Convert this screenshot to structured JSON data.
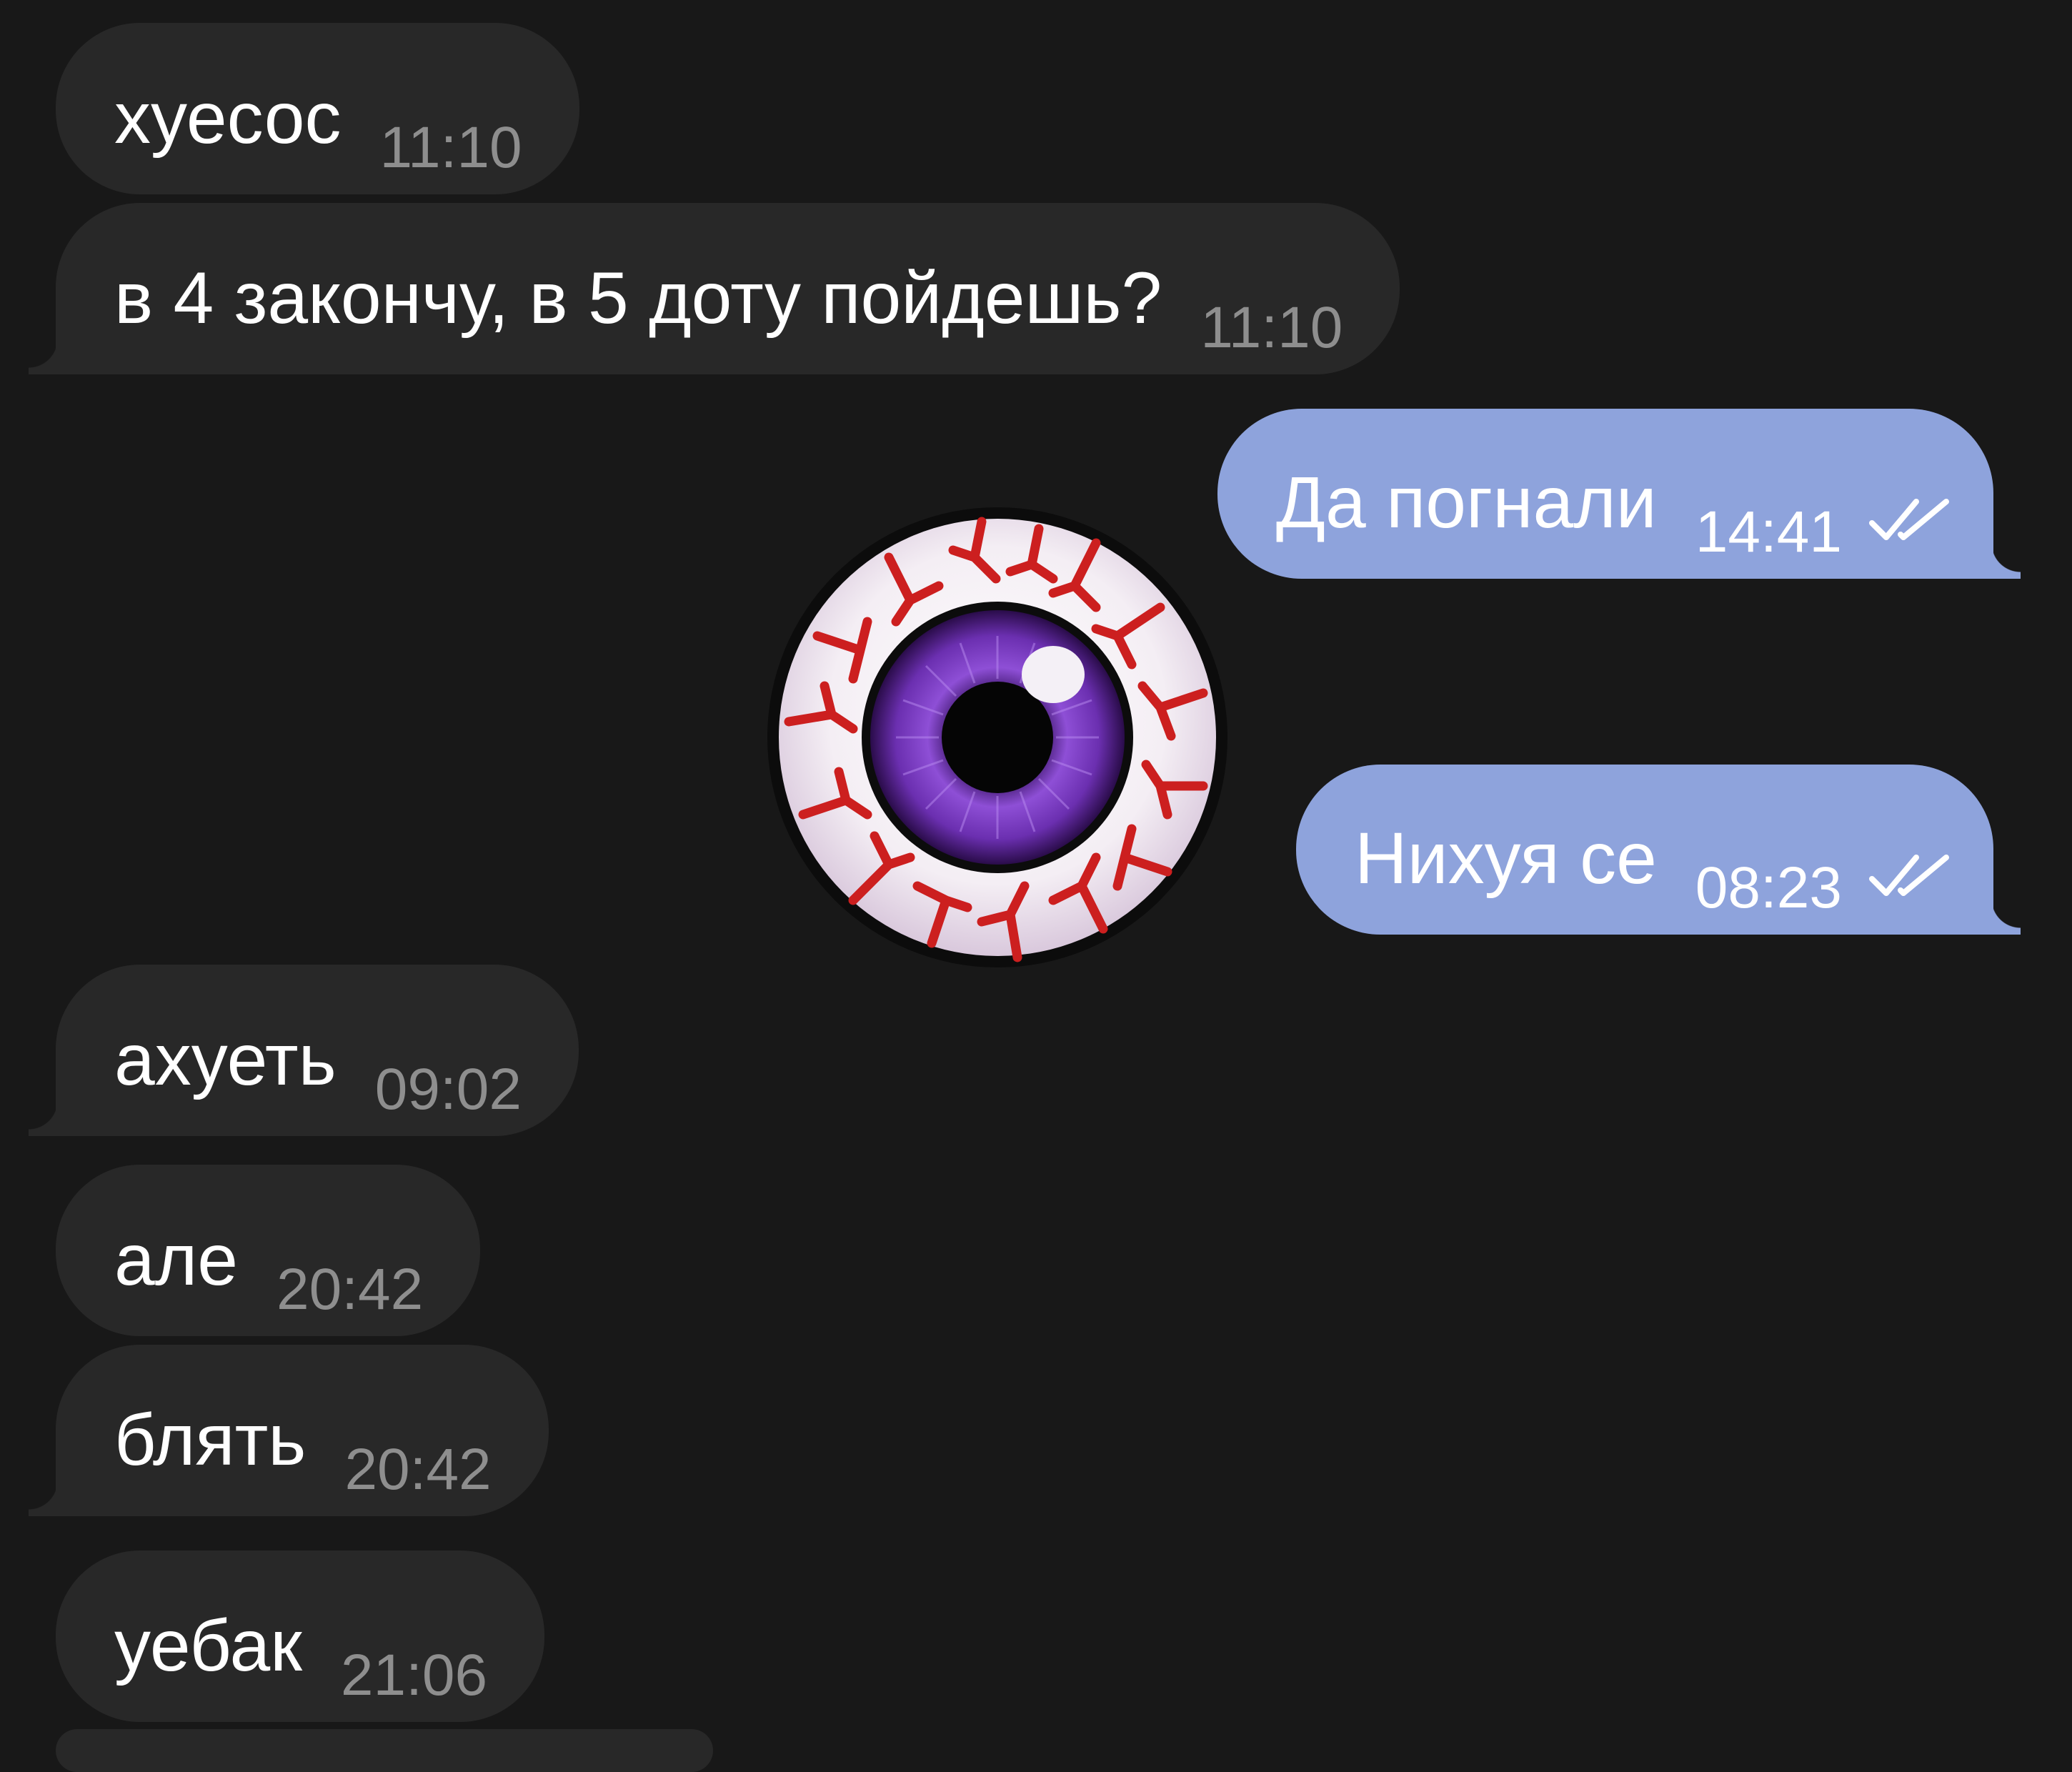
{
  "theme": {
    "background": "#181818",
    "incoming_bubble": "#282828",
    "outgoing_bubble": "#8ea3dc",
    "incoming_time": "#8e8e8e",
    "text": "#ffffff",
    "vein_red": "#cc1f1f",
    "iris_purple": "#6b2fb0"
  },
  "messages": [
    {
      "direction": "incoming",
      "text": "хуесос",
      "time": "11:10"
    },
    {
      "direction": "incoming",
      "text": "в 4 закончу, в 5 доту пойдешь?",
      "time": "11:10"
    },
    {
      "direction": "outgoing",
      "text": "Да погнали",
      "time": "14:41",
      "status_icon": "double-check-icon"
    },
    {
      "direction": "incoming",
      "type": "sticker",
      "sticker_icon": "bloodshot-eyeball-sticker"
    },
    {
      "direction": "outgoing",
      "text": "Нихуя се",
      "time": "08:23",
      "status_icon": "double-check-icon"
    },
    {
      "direction": "incoming",
      "text": "ахуеть",
      "time": "09:02"
    },
    {
      "direction": "incoming",
      "text": "але",
      "time": "20:42"
    },
    {
      "direction": "incoming",
      "text": "блять",
      "time": "20:42"
    },
    {
      "direction": "incoming",
      "text": "уебак",
      "time": "21:06"
    }
  ]
}
